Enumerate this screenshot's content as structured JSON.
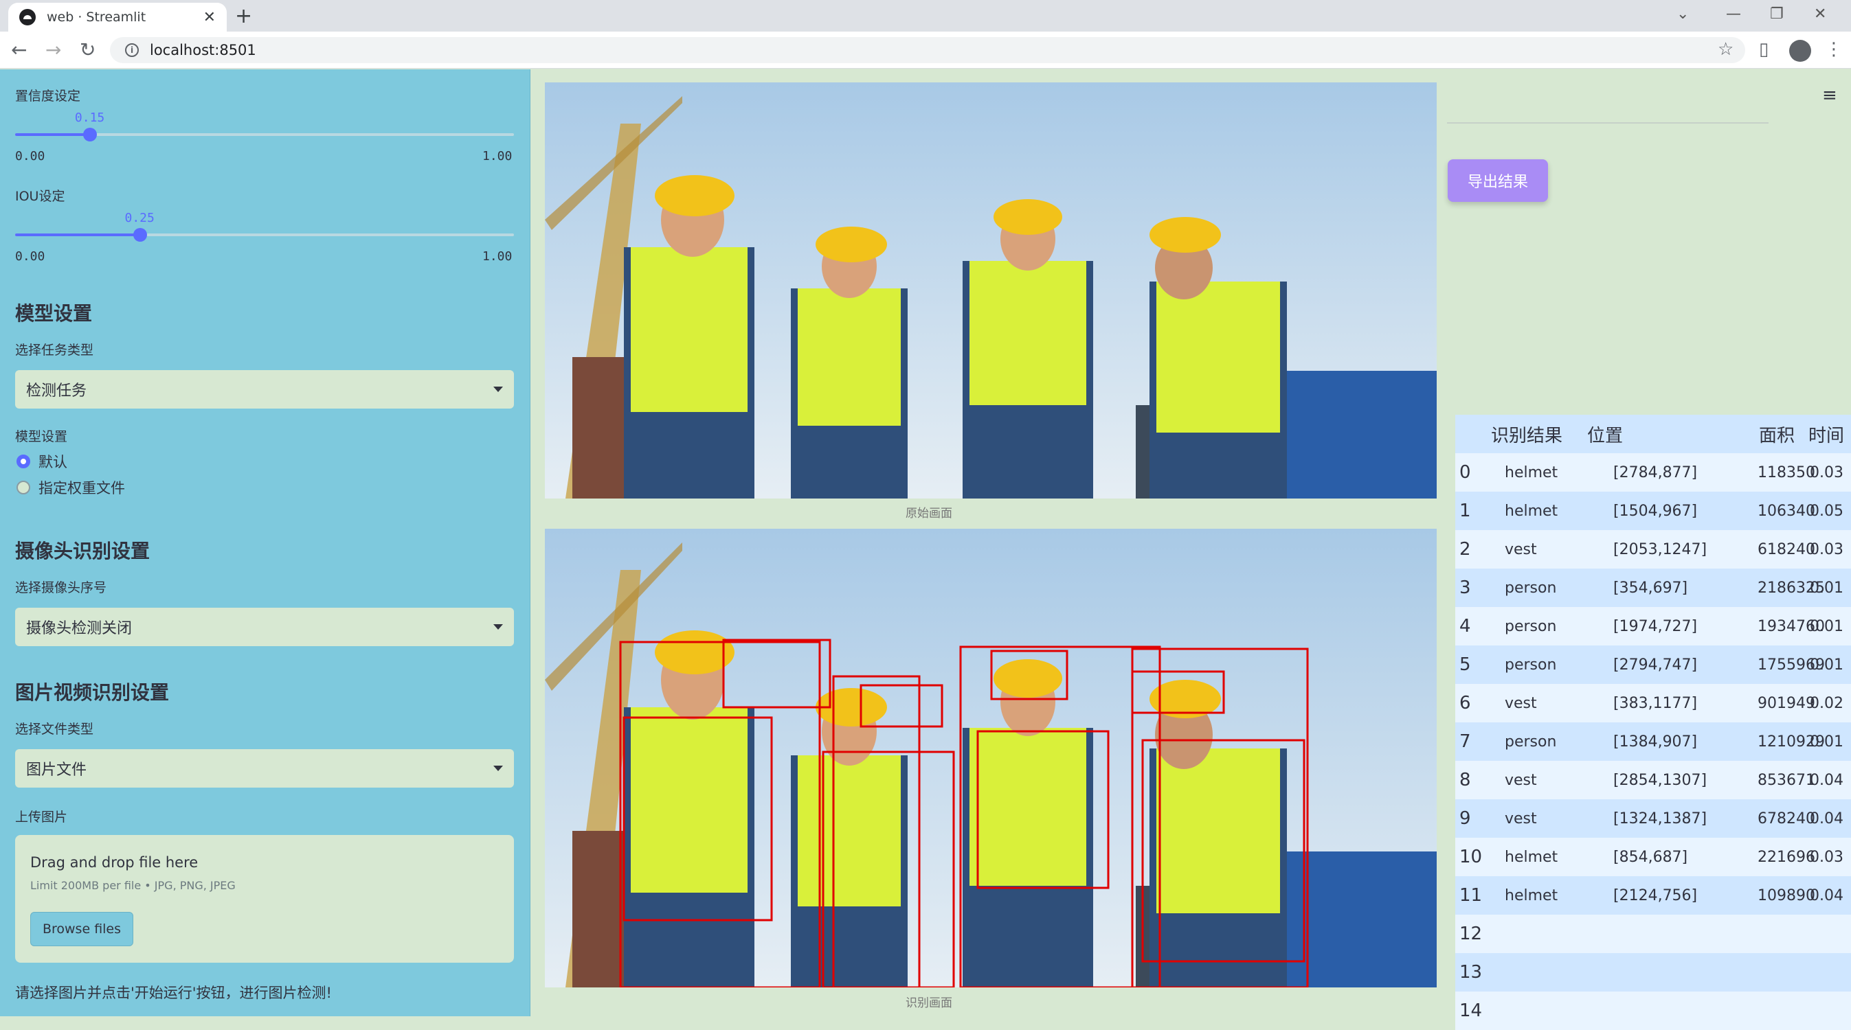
{
  "browser": {
    "tab_title": "web · Streamlit",
    "url": "localhost:8501"
  },
  "sidebar": {
    "conf_label": "置信度设定",
    "conf_value": "0.15",
    "conf_min": "0.00",
    "conf_max": "1.00",
    "conf_fraction": 0.15,
    "iou_label": "IOU设定",
    "iou_value": "0.25",
    "iou_min": "0.00",
    "iou_max": "1.00",
    "iou_fraction": 0.25,
    "model_heading": "模型设置",
    "task_label": "选择任务类型",
    "task_value": "检测任务",
    "model_label": "模型设置",
    "radio_default": "默认",
    "radio_custom": "指定权重文件",
    "camera_heading": "摄像头识别设置",
    "camera_label": "选择摄像头序号",
    "camera_value": "摄像头检测关闭",
    "media_heading": "图片视频识别设置",
    "filetype_label": "选择文件类型",
    "filetype_value": "图片文件",
    "upload_label": "上传图片",
    "drag_text": "Drag and drop file here",
    "limit_text": "Limit 200MB per file • JPG, PNG, JPEG",
    "browse_label": "Browse files",
    "hint": "请选择图片并点击'开始运行'按钮，进行图片检测!"
  },
  "main": {
    "original_caption": "原始画面",
    "result_caption": "识别画面",
    "export_label": "导出结果"
  },
  "table": {
    "headers": [
      "识别结果",
      "位置",
      "面积",
      "时间"
    ],
    "rows": [
      {
        "idx": "0",
        "label": "helmet",
        "pos": "[2784,877]",
        "area": "118350",
        "time": "0.03"
      },
      {
        "idx": "1",
        "label": "helmet",
        "pos": "[1504,967]",
        "area": "106340",
        "time": "0.05"
      },
      {
        "idx": "2",
        "label": "vest",
        "pos": "[2053,1247]",
        "area": "618240",
        "time": "0.03"
      },
      {
        "idx": "3",
        "label": "person",
        "pos": "[354,697]",
        "area": "2186325",
        "time": "0.01"
      },
      {
        "idx": "4",
        "label": "person",
        "pos": "[1974,727]",
        "area": "1934760",
        "time": "0.01"
      },
      {
        "idx": "5",
        "label": "person",
        "pos": "[2794,747]",
        "area": "1755969",
        "time": "0.01"
      },
      {
        "idx": "6",
        "label": "vest",
        "pos": "[383,1177]",
        "area": "901949",
        "time": "0.02"
      },
      {
        "idx": "7",
        "label": "person",
        "pos": "[1384,907]",
        "area": "1210929",
        "time": "0.01"
      },
      {
        "idx": "8",
        "label": "vest",
        "pos": "[2854,1307]",
        "area": "853671",
        "time": "0.04"
      },
      {
        "idx": "9",
        "label": "vest",
        "pos": "[1324,1387]",
        "area": "678240",
        "time": "0.04"
      },
      {
        "idx": "10",
        "label": "helmet",
        "pos": "[854,687]",
        "area": "221696",
        "time": "0.03"
      },
      {
        "idx": "11",
        "label": "helmet",
        "pos": "[2124,756]",
        "area": "109890",
        "time": "0.04"
      },
      {
        "idx": "12",
        "label": "",
        "pos": "",
        "area": "",
        "time": ""
      },
      {
        "idx": "13",
        "label": "",
        "pos": "",
        "area": "",
        "time": ""
      },
      {
        "idx": "14",
        "label": "",
        "pos": "",
        "area": "",
        "time": ""
      }
    ]
  },
  "colors": {
    "sidebar_bg": "#7ec9dd",
    "main_bg": "#d7e8d2",
    "accent": "#5a6bff",
    "export_button": "#a98cf5",
    "box_color": "#e00000"
  }
}
